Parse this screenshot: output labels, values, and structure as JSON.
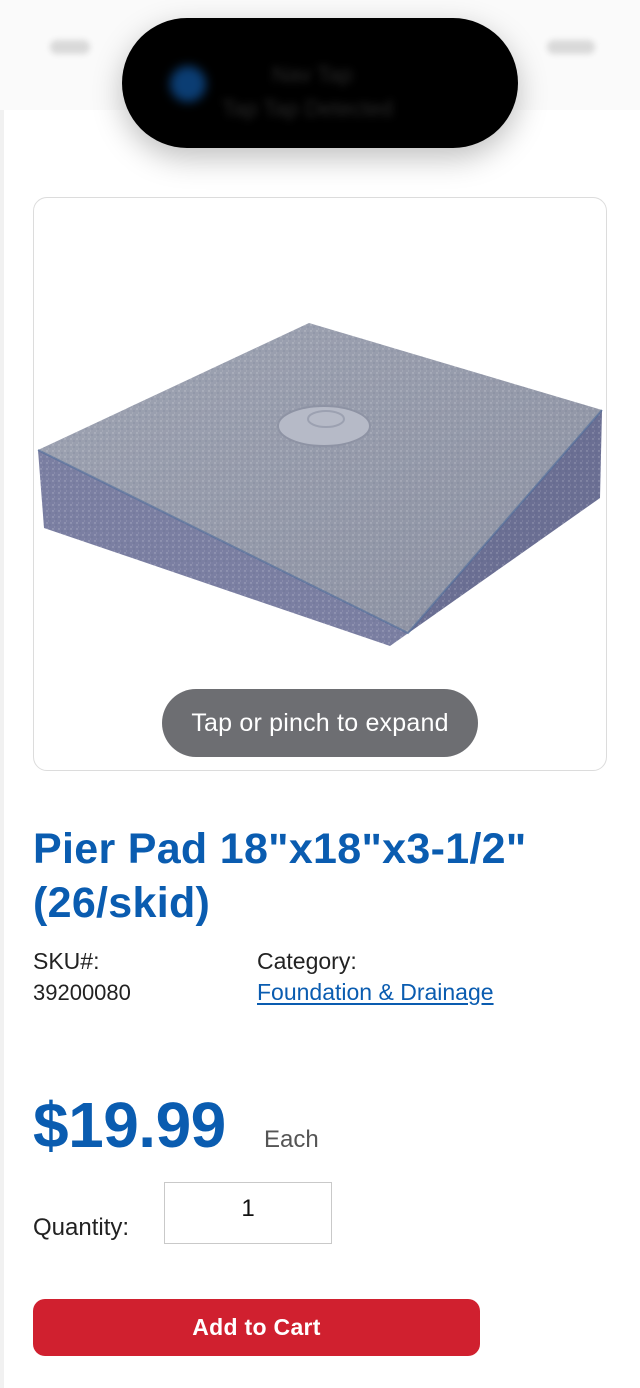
{
  "island": {
    "line1": "Nav Tap",
    "line2": "Tap Tap Detected"
  },
  "image": {
    "expand_hint": "Tap or pinch to expand"
  },
  "product": {
    "title": "Pier Pad 18\"x18\"x3-1/2\" (26/skid)",
    "sku_label": "SKU#:",
    "sku_value": "39200080",
    "category_label": "Category:",
    "category_value": "Foundation & Drainage",
    "price": "$19.99",
    "price_unit": "Each"
  },
  "quantity": {
    "label": "Quantity:",
    "value": "1"
  },
  "actions": {
    "add_to_cart": "Add to Cart"
  },
  "colors": {
    "brand_blue": "#0a5cb0",
    "cart_red": "#d0202f",
    "pill_gray": "#6d6e72"
  }
}
